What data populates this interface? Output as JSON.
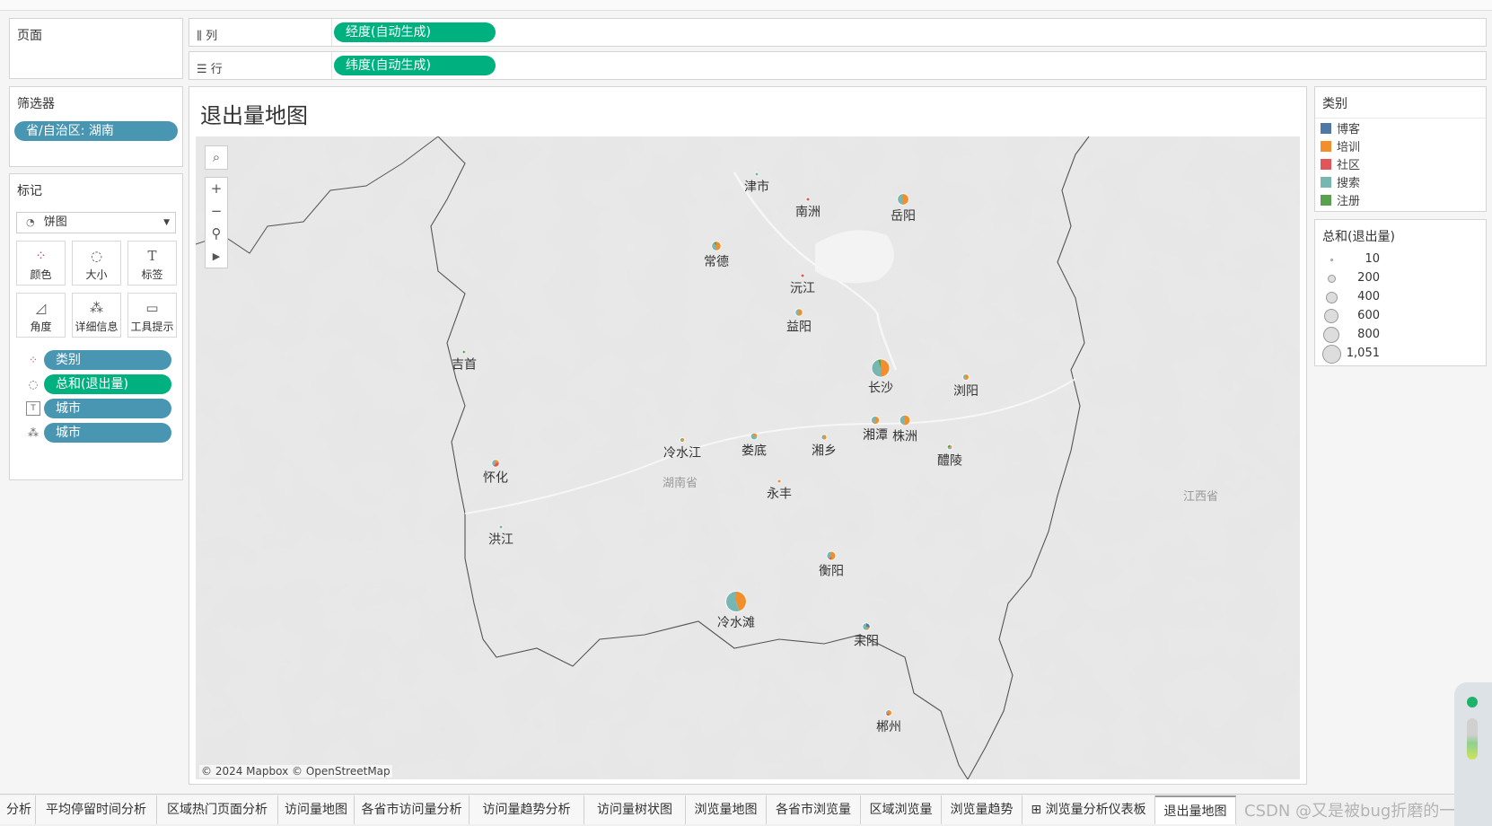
{
  "shelves": {
    "pages_title": "页面",
    "columns_label": "列",
    "rows_label": "行",
    "columns_pill": "经度(自动生成)",
    "rows_pill": "纬度(自动生成)"
  },
  "filters": {
    "title": "筛选器",
    "pill": "省/自治区: 湖南"
  },
  "marks": {
    "title": "标记",
    "type_value": "饼图",
    "buttons": [
      "颜色",
      "大小",
      "标签",
      "角度",
      "详细信息",
      "工具提示"
    ],
    "pills": [
      "类别",
      "总和(退出量)",
      "城市",
      "城市"
    ]
  },
  "view": {
    "title": "退出量地图",
    "attribution": "© 2024 Mapbox © OpenStreetMap",
    "province_label": "湖南省",
    "neighbor_label": "江西省"
  },
  "legend_color": {
    "title": "类别",
    "items": [
      {
        "label": "博客",
        "color": "#4e79a7"
      },
      {
        "label": "培训",
        "color": "#f28e2b"
      },
      {
        "label": "社区",
        "color": "#e15759"
      },
      {
        "label": "搜索",
        "color": "#76b7b2"
      },
      {
        "label": "注册",
        "color": "#59a14f"
      }
    ]
  },
  "legend_size": {
    "title": "总和(退出量)",
    "items": [
      "10",
      "200",
      "400",
      "600",
      "800",
      "1,051"
    ]
  },
  "cities": [
    {
      "name": "津市",
      "value": 10
    },
    {
      "name": "南洲",
      "value": 10
    },
    {
      "name": "岳阳",
      "value": 300
    },
    {
      "name": "常德",
      "value": 200
    },
    {
      "name": "沅江",
      "value": 20
    },
    {
      "name": "益阳",
      "value": 120
    },
    {
      "name": "吉首",
      "value": 20
    },
    {
      "name": "长沙",
      "value": 800
    },
    {
      "name": "浏阳",
      "value": 80
    },
    {
      "name": "湘潭",
      "value": 150
    },
    {
      "name": "株洲",
      "value": 250
    },
    {
      "name": "冷水江",
      "value": 40
    },
    {
      "name": "娄底",
      "value": 100
    },
    {
      "name": "湘乡",
      "value": 60
    },
    {
      "name": "醴陵",
      "value": 50
    },
    {
      "name": "怀化",
      "value": 120
    },
    {
      "name": "永丰",
      "value": 10
    },
    {
      "name": "洪江",
      "value": 10
    },
    {
      "name": "衡阳",
      "value": 180
    },
    {
      "name": "冷水滩",
      "value": 1051
    },
    {
      "name": "耒阳",
      "value": 120
    },
    {
      "name": "郴州",
      "value": 80
    }
  ],
  "tabs": [
    {
      "label": "分析",
      "active": false
    },
    {
      "label": "平均停留时间分析",
      "active": false
    },
    {
      "label": "区域热门页面分析",
      "active": false
    },
    {
      "label": "访问量地图",
      "active": false
    },
    {
      "label": "各省市访问量分析",
      "active": false
    },
    {
      "label": "访问量趋势分析",
      "active": false
    },
    {
      "label": "访问量树状图",
      "active": false
    },
    {
      "label": "浏览量地图",
      "active": false
    },
    {
      "label": "各省市浏览量",
      "active": false
    },
    {
      "label": "区域浏览量",
      "active": false
    },
    {
      "label": "浏览量趋势",
      "active": false
    },
    {
      "label": "⊞ 浏览量分析仪表板",
      "active": false
    },
    {
      "label": "退出量地图",
      "active": true
    }
  ],
  "watermark": "CSDN @又是被bug折磨的一天"
}
